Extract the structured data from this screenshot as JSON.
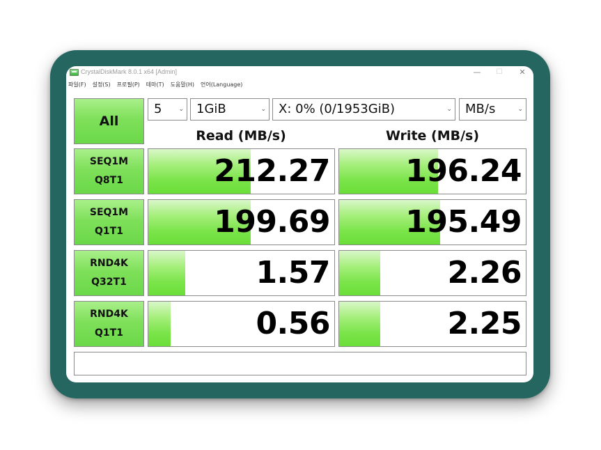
{
  "window": {
    "title": "CrystalDiskMark 8.0.1 x64 [Admin]",
    "minimize_glyph": "—",
    "maximize_glyph": "☐",
    "close_glyph": "✕"
  },
  "menu": [
    "파일(F)",
    "설정(S)",
    "프로필(P)",
    "테마(T)",
    "도움말(H)",
    "언어(Language)"
  ],
  "controls": {
    "all_label": "All",
    "count": "5",
    "size": "1GiB",
    "drive": "X: 0% (0/1953GiB)",
    "unit": "MB/s",
    "dropdown_glyph": "⌄"
  },
  "headers": {
    "read": "Read (MB/s)",
    "write": "Write (MB/s)"
  },
  "rows": [
    {
      "line1": "SEQ1M",
      "line2": "Q8T1",
      "read": "212.27",
      "write": "196.24",
      "read_fill": 0.55,
      "write_fill": 0.53
    },
    {
      "line1": "SEQ1M",
      "line2": "Q1T1",
      "read": "199.69",
      "write": "195.49",
      "read_fill": 0.55,
      "write_fill": 0.54
    },
    {
      "line1": "RND4K",
      "line2": "Q32T1",
      "read": "1.57",
      "write": "2.26",
      "read_fill": 0.2,
      "write_fill": 0.22
    },
    {
      "line1": "RND4K",
      "line2": "Q1T1",
      "read": "0.56",
      "write": "2.25",
      "read_fill": 0.12,
      "write_fill": 0.22
    }
  ],
  "comment": "",
  "colors": {
    "frame": "#256660",
    "bar": "#7be44a",
    "button": "#7fe05a"
  }
}
